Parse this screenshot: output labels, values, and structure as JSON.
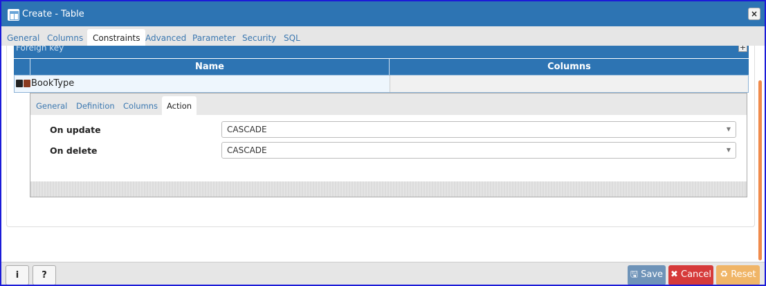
{
  "dialog": {
    "title": "Create - Table",
    "close_label": "×"
  },
  "tabs": [
    "General",
    "Columns",
    "Constraints",
    "Advanced",
    "Parameter",
    "Security",
    "SQL"
  ],
  "active_tab": "Constraints",
  "foreign_key": {
    "section_title": "Foreign key",
    "add_label": "+",
    "columns": [
      "Name",
      "Columns"
    ],
    "rows": [
      {
        "name": "BookType",
        "columns": ""
      }
    ]
  },
  "sub_tabs": [
    "General",
    "Definition",
    "Columns",
    "Action"
  ],
  "active_sub_tab": "Action",
  "action": {
    "on_update_label": "On update",
    "on_update_value": "CASCADE",
    "on_delete_label": "On delete",
    "on_delete_value": "CASCADE"
  },
  "footer": {
    "info_label": "i",
    "help_label": "?",
    "save_label": "Save",
    "cancel_label": "Cancel",
    "reset_label": "Reset"
  },
  "colors": {
    "brand": "#2d74b3",
    "save": "#6e93b8",
    "cancel": "#d63a3a",
    "reset": "#f0b567"
  }
}
